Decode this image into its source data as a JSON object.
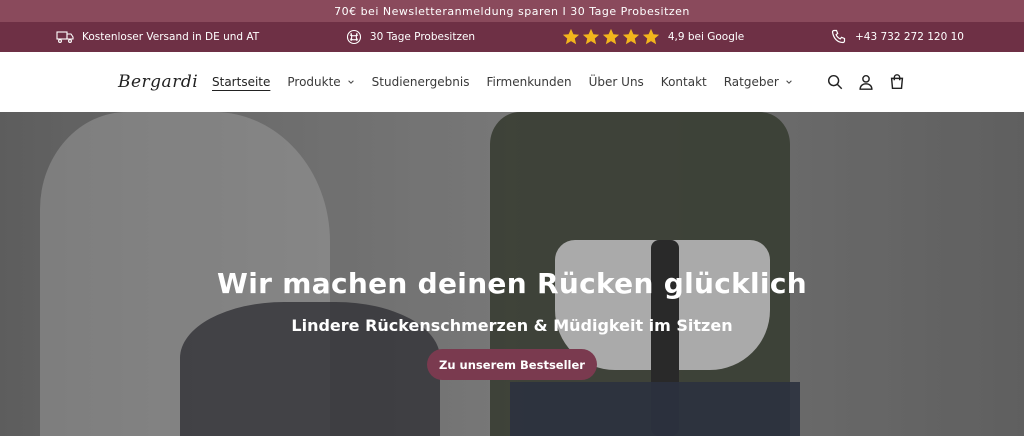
{
  "announcement": "70€ bei Newsletteranmeldung sparen I 30 Tage Probesitzen",
  "usp": {
    "shipping": "Kostenloser Versand in DE und AT",
    "trial": "30 Tage Probesitzen",
    "rating": "4,9 bei Google",
    "phone": "+43 732 272 120 10"
  },
  "header": {
    "logo": "Bergardi",
    "nav": [
      {
        "label": "Startseite"
      },
      {
        "label": "Produkte"
      },
      {
        "label": "Studienergebnis"
      },
      {
        "label": "Firmenkunden"
      },
      {
        "label": "Über Uns"
      },
      {
        "label": "Kontakt"
      },
      {
        "label": "Ratgeber"
      }
    ]
  },
  "hero": {
    "title": "Wir machen deinen Rücken glücklich",
    "subtitle": "Lindere Rückenschmerzen & Müdigkeit im Sitzen",
    "cta": "Zu unserem Bestseller"
  },
  "colors": {
    "announce_bg": "#8a4a5c",
    "usp_bg": "#6e3045",
    "accent": "#7a3a4f",
    "star": "#f3b51c"
  }
}
